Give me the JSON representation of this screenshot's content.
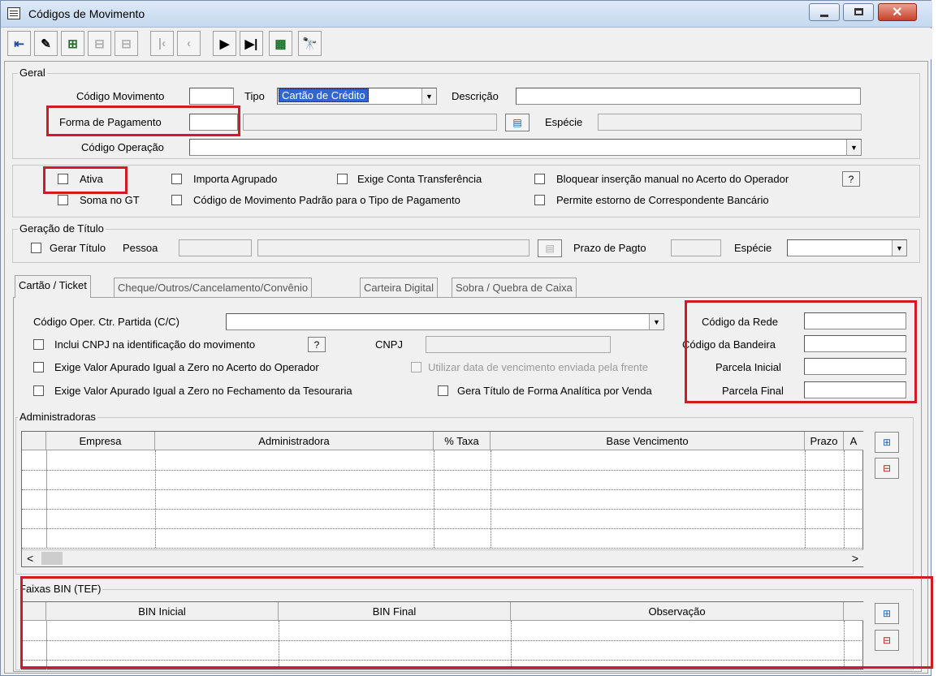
{
  "window": {
    "title": "Códigos de Movimento"
  },
  "toolbar": {
    "buttons": [
      "exit",
      "eraser",
      "add",
      "edit",
      "delete",
      "first",
      "prev",
      "next",
      "last",
      "grid",
      "search"
    ]
  },
  "geral": {
    "group_label": "Geral",
    "codigo_movimento_label": "Código Movimento",
    "codigo_movimento_value": "",
    "tipo_label": "Tipo",
    "tipo_value": "Cartão de Crédito",
    "descricao_label": "Descrição",
    "descricao_value": "",
    "forma_pagamento_label": "Forma de Pagamento",
    "forma_pagamento_value": "",
    "especie_label": "Espécie",
    "codigo_operacao_label": "Código Operação",
    "codigo_operacao_value": ""
  },
  "flags": {
    "ativa": "Ativa",
    "soma_gt": "Soma no GT",
    "importa_agrupado": "Importa Agrupado",
    "padrao_tipo_pagamento": "Código de Movimento Padrão para o Tipo de Pagamento",
    "exige_conta": "Exige Conta Transferência",
    "bloquear": "Bloquear inserção manual no Acerto do Operador",
    "permite_estorno": "Permite estorno de Correspondente Bancário",
    "help": "?"
  },
  "titulo": {
    "group_label": "Geração de Título",
    "gerar_titulo": "Gerar Título",
    "pessoa_label": "Pessoa",
    "prazo_label": "Prazo de Pagto",
    "especie_label": "Espécie"
  },
  "tabs": [
    "Cartão / Ticket",
    "Cheque/Outros/Cancelamento/Convênio",
    "Carteira Digital",
    "Sobra / Quebra de Caixa"
  ],
  "cartao": {
    "codigo_oper_label": "Código Oper. Ctr. Partida (C/C)",
    "inclui_cnpj": "Inclui CNPJ na identificação do movimento",
    "cnpj_label": "CNPJ",
    "exige_zero_acerto": "Exige Valor Apurado Igual a Zero no Acerto do Operador",
    "utilizar_data": "Utilizar data de vencimento enviada pela frente",
    "exige_zero_fechamento": "Exige Valor Apurado Igual a Zero no Fechamento da Tesouraria",
    "gera_titulo_analitico": "Gera Título de Forma Analítica por Venda",
    "codigo_rede_label": "Código da Rede",
    "codigo_bandeira_label": "Código da Bandeira",
    "parcela_inicial_label": "Parcela Inicial",
    "parcela_final_label": "Parcela Final",
    "help": "?"
  },
  "administradoras": {
    "group_label": "Administradoras",
    "columns": [
      "Empresa",
      "Administradora",
      "% Taxa",
      "Base Vencimento",
      "Prazo",
      "A"
    ],
    "scroll_left": "<",
    "scroll_right": ">"
  },
  "faixas": {
    "group_label": "Faixas BIN (TEF)",
    "columns": [
      "BIN Inicial",
      "BIN Final",
      "Observação"
    ]
  },
  "colors": {
    "highlight": "#d01a24",
    "selection": "#3366cc"
  }
}
